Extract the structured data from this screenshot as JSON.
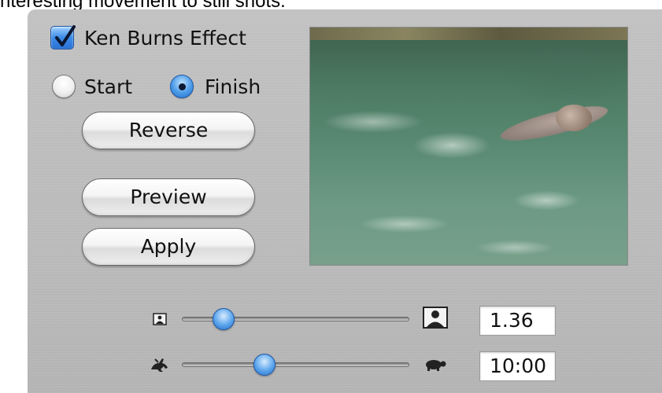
{
  "caption": "nteresting movement to still shots.",
  "ken_burns": {
    "label": "Ken Burns Effect",
    "checked": true
  },
  "radios": [
    {
      "label": "Start",
      "selected": false
    },
    {
      "label": "Finish",
      "selected": true
    }
  ],
  "buttons": {
    "reverse": "Reverse",
    "preview": "Preview",
    "apply": "Apply"
  },
  "zoom": {
    "value": "1.36",
    "min_icon": "small-portrait-icon",
    "max_icon": "large-portrait-icon",
    "level": 0.15
  },
  "duration": {
    "value": "10:00",
    "min_icon": "rabbit-icon",
    "max_icon": "turtle-icon",
    "level": 0.35
  },
  "colors": {
    "accent": "#3b8ae6",
    "panel": "#bdbdbd"
  }
}
